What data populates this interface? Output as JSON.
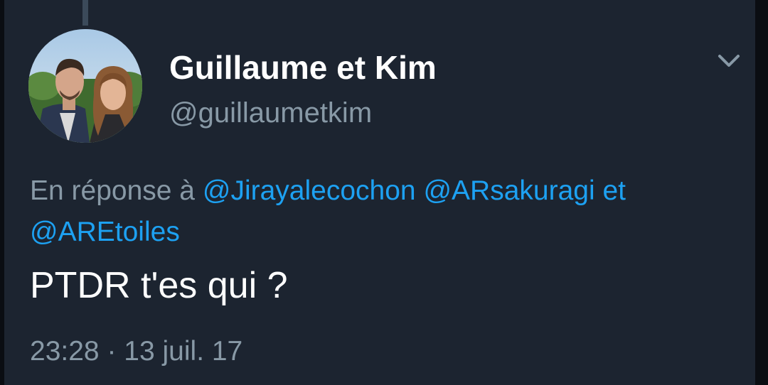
{
  "tweet": {
    "author": {
      "display_name": "Guillaume et Kim",
      "handle": "@guillaumetkim",
      "avatar": "avatar-photo"
    },
    "reply_context": {
      "prefix": "En réponse à",
      "mentions": [
        "@Jirayalecochon",
        "@ARsakuragi",
        "@AREtoiles"
      ],
      "conjunction": "et"
    },
    "text": "PTDR t'es qui ?",
    "time": "23:28",
    "separator": "·",
    "date": "13 juil. 17",
    "menu_icon": "chevron-down-icon"
  },
  "colors": {
    "background": "#1c2430",
    "text_primary": "#ffffff",
    "text_secondary": "#8899a6",
    "link": "#1da1f2"
  }
}
